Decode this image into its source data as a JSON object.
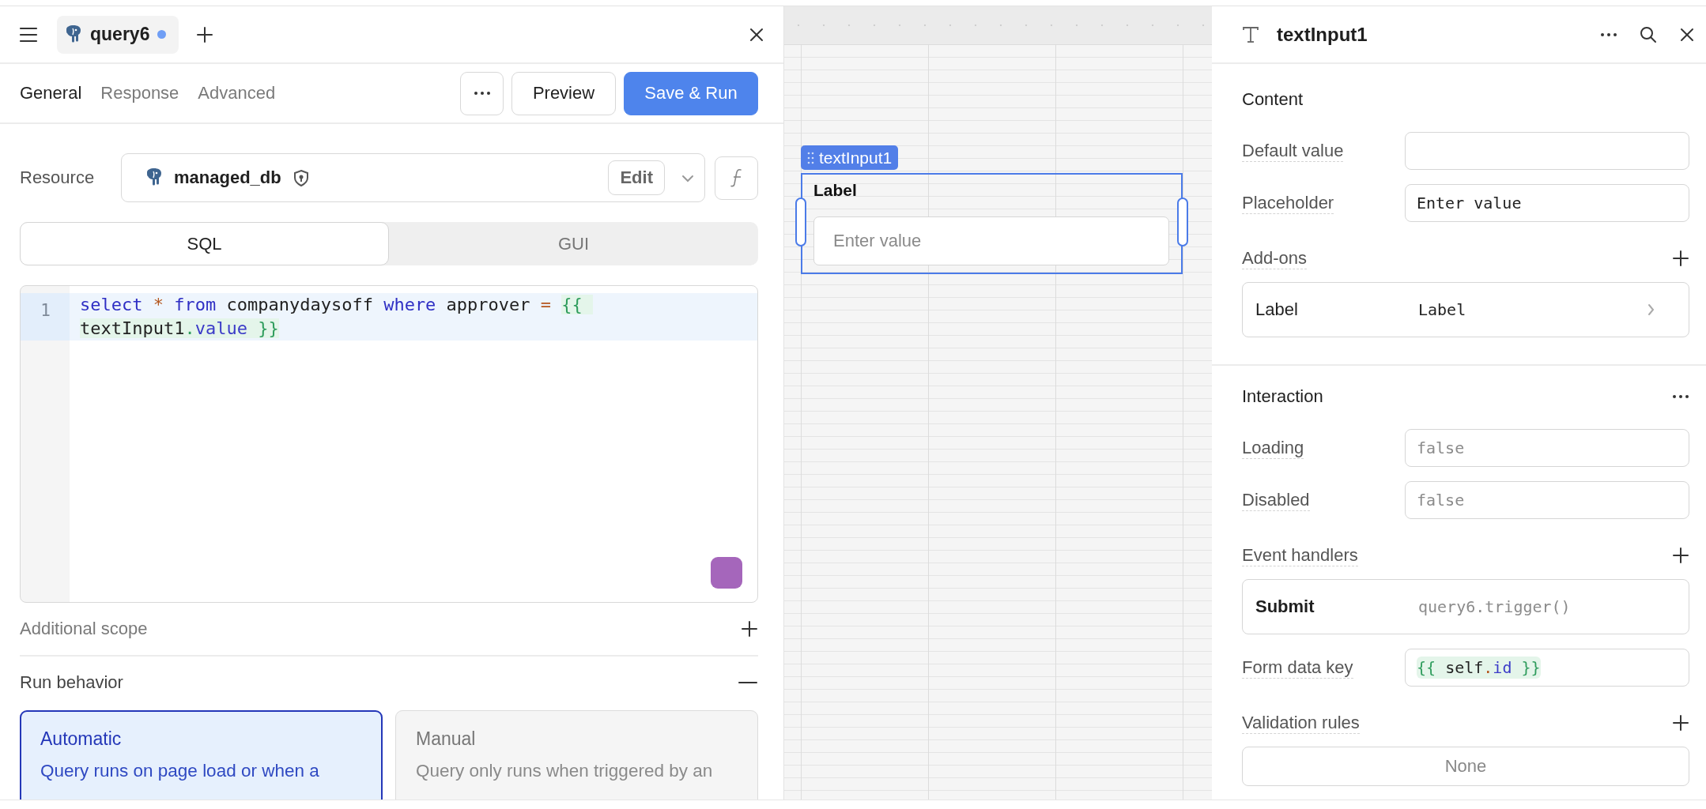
{
  "query_panel": {
    "open_query": {
      "label": "query6",
      "unsaved": true
    },
    "tabs": [
      {
        "label": "General",
        "selected": true
      },
      {
        "label": "Response",
        "selected": false
      },
      {
        "label": "Advanced",
        "selected": false
      }
    ],
    "preview_button": "Preview",
    "run_button": "Save & Run",
    "resource": {
      "label": "Resource",
      "name": "managed_db",
      "edit_button": "Edit"
    },
    "mode": [
      {
        "label": "SQL",
        "selected": true
      },
      {
        "label": "GUI",
        "selected": false
      }
    ],
    "editor": {
      "lines": [
        {
          "number": "1",
          "active": true,
          "tokens": [
            {
              "kind": "keyword",
              "text": "select"
            },
            {
              "kind": "operator",
              "text": " * "
            },
            {
              "kind": "keyword",
              "text": "from"
            },
            {
              "kind": "plain",
              "text": " companydaysoff "
            },
            {
              "kind": "keyword",
              "text": "where"
            },
            {
              "kind": "plain",
              "text": " approver "
            },
            {
              "kind": "operator",
              "text": "= "
            },
            {
              "kind": "template",
              "parts": [
                {
                  "kind": "brace",
                  "text": "{{ "
                },
                {
                  "kind": "plain",
                  "text": "textInput1"
                },
                {
                  "kind": "brace",
                  "text": "."
                },
                {
                  "kind": "property",
                  "text": "value"
                },
                {
                  "kind": "brace",
                  "text": " }}"
                }
              ]
            }
          ]
        }
      ]
    },
    "sections": [
      {
        "label": "Additional scope",
        "expanded": false
      },
      {
        "label": "Run behavior",
        "expanded": true
      }
    ],
    "run_options": [
      {
        "title": "Automatic",
        "description": "Query runs on page load or when a",
        "selected": true
      },
      {
        "title": "Manual",
        "description": "Query only runs when triggered by an",
        "selected": false
      }
    ]
  },
  "canvas": {
    "component": {
      "tag": "textInput1",
      "label": "Label",
      "placeholder": "Enter value",
      "selected": true
    }
  },
  "inspector": {
    "title": "textInput1",
    "sections": [
      {
        "title": "Content",
        "has_menu": false,
        "rows": [
          {
            "kind": "field",
            "label": "Default value"
          },
          {
            "kind": "field",
            "label": "Placeholder",
            "value": "Enter value"
          },
          {
            "kind": "list",
            "label": "Add-ons"
          },
          {
            "kind": "addon",
            "name": "Label",
            "value": "Label"
          }
        ]
      },
      {
        "title": "Interaction",
        "has_menu": true,
        "rows": [
          {
            "kind": "field",
            "label": "Loading",
            "placeholder": "false"
          },
          {
            "kind": "field",
            "label": "Disabled",
            "placeholder": "false"
          },
          {
            "kind": "list",
            "label": "Event handlers"
          },
          {
            "kind": "handler",
            "name": "Submit",
            "value": "query6.trigger()"
          },
          {
            "kind": "field",
            "label": "Form data key",
            "tokens": [
              {
                "kind": "template",
                "parts": [
                  {
                    "kind": "brace",
                    "text": "{{ "
                  },
                  {
                    "kind": "plain",
                    "text": "self"
                  },
                  {
                    "kind": "operator",
                    "text": "."
                  },
                  {
                    "kind": "property",
                    "text": "id"
                  },
                  {
                    "kind": "brace",
                    "text": " }}"
                  }
                ]
              }
            ]
          },
          {
            "kind": "list",
            "label": "Validation rules"
          },
          {
            "kind": "empty",
            "text": "None"
          }
        ]
      }
    ]
  }
}
